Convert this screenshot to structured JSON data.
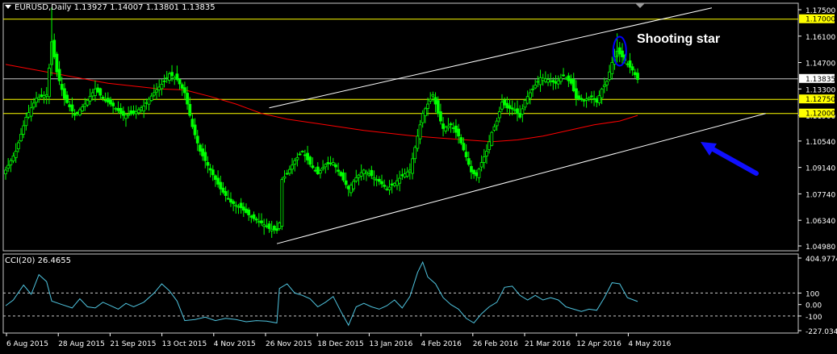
{
  "header": {
    "symbol": "EURUSD,Daily",
    "ohlc": "1.13927 1.14007 1.13801 1.13835",
    "cci_label": "CCI(20) 26.4655"
  },
  "annotation": {
    "text": "Shooting star"
  },
  "colors": {
    "background": "#000000",
    "bull_candle": "#00ff00",
    "bear_candle": "#00ff00",
    "moving_average": "#ff0000",
    "trendline": "#ffffff",
    "horizontal_line": "#ffff00",
    "cci_line": "#4fc4df",
    "arrow": "#1010ff",
    "ellipse": "#0000ff"
  },
  "chart_data": [
    {
      "type": "candlestick",
      "symbol": "EURUSD",
      "timeframe": "Daily",
      "price_axis_ticks": [
        "1.17500",
        "1.16100",
        "1.14700",
        "1.13300",
        "1.11900",
        "1.10540",
        "1.09140",
        "1.07740",
        "1.06340",
        "1.04980"
      ],
      "highlighted_levels": [
        "1.17000",
        "1.12750",
        "1.12000"
      ],
      "current_price": "1.13835",
      "time_axis_labels": [
        "6 Aug 2015",
        "28 Aug 2015",
        "21 Sep 2015",
        "13 Oct 2015",
        "4 Nov 2015",
        "26 Nov 2015",
        "18 Dec 2015",
        "13 Jan 2016",
        "4 Feb 2016",
        "26 Feb 2016",
        "21 Mar 2016",
        "12 Apr 2016",
        "4 May 2016"
      ],
      "ylim": [
        1.0498,
        1.1763
      ],
      "anchors": [
        [
          0,
          1.09
        ],
        [
          4,
          1.1
        ],
        [
          8,
          1.118
        ],
        [
          12,
          1.128
        ],
        [
          16,
          1.13
        ],
        [
          18,
          1.158
        ],
        [
          20,
          1.142
        ],
        [
          23,
          1.128
        ],
        [
          27,
          1.119
        ],
        [
          31,
          1.125
        ],
        [
          35,
          1.133
        ],
        [
          38,
          1.128
        ],
        [
          42,
          1.124
        ],
        [
          46,
          1.119
        ],
        [
          50,
          1.12
        ],
        [
          54,
          1.124
        ],
        [
          58,
          1.131
        ],
        [
          62,
          1.137
        ],
        [
          64,
          1.141
        ],
        [
          67,
          1.138
        ],
        [
          70,
          1.131
        ],
        [
          73,
          1.113
        ],
        [
          76,
          1.1
        ],
        [
          80,
          1.09
        ],
        [
          84,
          1.08
        ],
        [
          88,
          1.073
        ],
        [
          92,
          1.07
        ],
        [
          96,
          1.065
        ],
        [
          100,
          1.062
        ],
        [
          103,
          1.059
        ],
        [
          106,
          1.058
        ],
        [
          107,
          1.062
        ],
        [
          108,
          1.085
        ],
        [
          110,
          1.088
        ],
        [
          113,
          1.095
        ],
        [
          116,
          1.1
        ],
        [
          119,
          1.093
        ],
        [
          122,
          1.088
        ],
        [
          125,
          1.093
        ],
        [
          128,
          1.094
        ],
        [
          131,
          1.087
        ],
        [
          134,
          1.08
        ],
        [
          137,
          1.086
        ],
        [
          140,
          1.09
        ],
        [
          143,
          1.087
        ],
        [
          146,
          1.084
        ],
        [
          149,
          1.08
        ],
        [
          152,
          1.083
        ],
        [
          155,
          1.087
        ],
        [
          158,
          1.09
        ],
        [
          161,
          1.108
        ],
        [
          163,
          1.12
        ],
        [
          165,
          1.125
        ],
        [
          167,
          1.13
        ],
        [
          169,
          1.12
        ],
        [
          171,
          1.112
        ],
        [
          174,
          1.114
        ],
        [
          177,
          1.108
        ],
        [
          180,
          1.097
        ],
        [
          182,
          1.089
        ],
        [
          184,
          1.087
        ],
        [
          186,
          1.094
        ],
        [
          188,
          1.1
        ],
        [
          190,
          1.11
        ],
        [
          192,
          1.116
        ],
        [
          194,
          1.126
        ],
        [
          196,
          1.123
        ],
        [
          199,
          1.122
        ],
        [
          201,
          1.118
        ],
        [
          203,
          1.127
        ],
        [
          206,
          1.133
        ],
        [
          209,
          1.139
        ],
        [
          212,
          1.138
        ],
        [
          215,
          1.136
        ],
        [
          218,
          1.14
        ],
        [
          221,
          1.136
        ],
        [
          223,
          1.128
        ],
        [
          226,
          1.127
        ],
        [
          229,
          1.129
        ],
        [
          231,
          1.126
        ],
        [
          233,
          1.133
        ],
        [
          235,
          1.137
        ],
        [
          237,
          1.147
        ],
        [
          239,
          1.153
        ],
        [
          241,
          1.15
        ],
        [
          243,
          1.146
        ],
        [
          245,
          1.143
        ],
        [
          247,
          1.138
        ]
      ],
      "moving_average": [
        [
          0,
          1.146
        ],
        [
          20,
          1.141
        ],
        [
          40,
          1.136
        ],
        [
          60,
          1.133
        ],
        [
          70,
          1.1325
        ],
        [
          80,
          1.129
        ],
        [
          90,
          1.125
        ],
        [
          100,
          1.12
        ],
        [
          110,
          1.117
        ],
        [
          120,
          1.115
        ],
        [
          140,
          1.111
        ],
        [
          160,
          1.108
        ],
        [
          170,
          1.107
        ],
        [
          180,
          1.106
        ],
        [
          190,
          1.105
        ],
        [
          200,
          1.106
        ],
        [
          210,
          1.108
        ],
        [
          220,
          1.111
        ],
        [
          230,
          1.114
        ],
        [
          240,
          1.116
        ],
        [
          247,
          1.119
        ]
      ],
      "trendlines": [
        {
          "from": [
            103,
            1.123
          ],
          "to": [
            276,
            1.176
          ]
        },
        {
          "from": [
            106,
            1.051
          ],
          "to": [
            297,
            1.12
          ]
        }
      ],
      "cci": {
        "ylim": [
          -227.0348,
          404.9774
        ],
        "tick_labels": [
          "404.9774",
          "100",
          "0.00",
          "-100",
          "-227.0348"
        ],
        "levels": [
          100,
          -100
        ],
        "current": 26.4655,
        "points": [
          [
            0,
            -10
          ],
          [
            3,
            40
          ],
          [
            7,
            170
          ],
          [
            10,
            90
          ],
          [
            13,
            260
          ],
          [
            16,
            200
          ],
          [
            18,
            30
          ],
          [
            22,
            0
          ],
          [
            26,
            -30
          ],
          [
            29,
            50
          ],
          [
            32,
            -20
          ],
          [
            35,
            -30
          ],
          [
            38,
            20
          ],
          [
            41,
            -10
          ],
          [
            44,
            -40
          ],
          [
            47,
            10
          ],
          [
            50,
            -20
          ],
          [
            54,
            20
          ],
          [
            58,
            100
          ],
          [
            61,
            180
          ],
          [
            64,
            120
          ],
          [
            67,
            30
          ],
          [
            70,
            -140
          ],
          [
            74,
            -130
          ],
          [
            78,
            -110
          ],
          [
            82,
            -140
          ],
          [
            86,
            -120
          ],
          [
            90,
            -130
          ],
          [
            94,
            -150
          ],
          [
            98,
            -140
          ],
          [
            102,
            -145
          ],
          [
            106,
            -160
          ],
          [
            107,
            140
          ],
          [
            110,
            180
          ],
          [
            113,
            100
          ],
          [
            116,
            80
          ],
          [
            119,
            50
          ],
          [
            122,
            -20
          ],
          [
            125,
            20
          ],
          [
            128,
            70
          ],
          [
            131,
            -60
          ],
          [
            134,
            -180
          ],
          [
            137,
            -20
          ],
          [
            140,
            10
          ],
          [
            143,
            -20
          ],
          [
            146,
            -40
          ],
          [
            149,
            -10
          ],
          [
            152,
            40
          ],
          [
            155,
            -30
          ],
          [
            158,
            70
          ],
          [
            161,
            280
          ],
          [
            163,
            370
          ],
          [
            165,
            240
          ],
          [
            168,
            180
          ],
          [
            171,
            60
          ],
          [
            174,
            0
          ],
          [
            177,
            -40
          ],
          [
            180,
            -120
          ],
          [
            183,
            -160
          ],
          [
            186,
            -80
          ],
          [
            189,
            -20
          ],
          [
            192,
            20
          ],
          [
            195,
            150
          ],
          [
            198,
            160
          ],
          [
            201,
            80
          ],
          [
            204,
            40
          ],
          [
            207,
            80
          ],
          [
            210,
            40
          ],
          [
            213,
            60
          ],
          [
            216,
            40
          ],
          [
            219,
            -20
          ],
          [
            222,
            -40
          ],
          [
            225,
            -60
          ],
          [
            228,
            -40
          ],
          [
            231,
            -50
          ],
          [
            234,
            60
          ],
          [
            237,
            190
          ],
          [
            240,
            180
          ],
          [
            243,
            60
          ],
          [
            247,
            26.47
          ]
        ]
      }
    }
  ]
}
